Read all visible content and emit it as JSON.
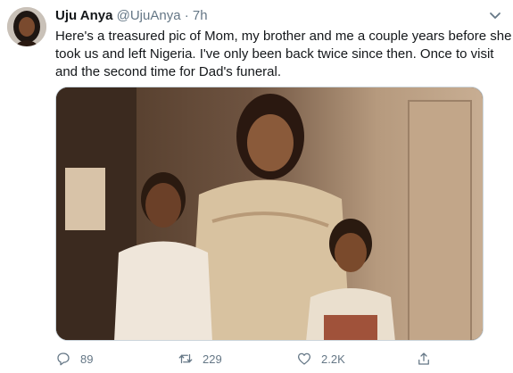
{
  "tweet": {
    "author_name": "Uju Anya",
    "handle": "@UjuAnya",
    "separator": "·",
    "time": "7h",
    "text_lines": [
      "Here's a treasured pic of Mom, my brother and me a couple years before she",
      "took us and left Nigeria. I've only been back twice since then. Once to visit",
      "and the second time for Dad's funeral."
    ]
  },
  "actions": {
    "replies": "89",
    "retweets": "229",
    "likes": "2.2K"
  },
  "colors": {
    "text": "#14171a",
    "secondary": "#657786",
    "border": "#ccd6dd"
  },
  "icons": [
    "more-chevron-icon",
    "reply-icon",
    "retweet-icon",
    "like-icon",
    "share-icon"
  ]
}
